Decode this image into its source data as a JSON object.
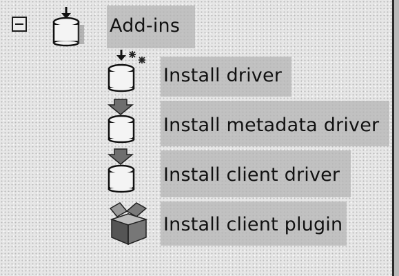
{
  "tree": {
    "root": {
      "label": "Add-ins",
      "expanded": true,
      "icon": "database-install-icon"
    },
    "children": [
      {
        "label": "Install driver",
        "icon": "database-install-sparkle-icon"
      },
      {
        "label": "Install metadata driver",
        "icon": "database-arrow-icon"
      },
      {
        "label": "Install client driver",
        "icon": "database-arrow-icon"
      },
      {
        "label": "Install client plugin",
        "icon": "package-box-icon"
      }
    ]
  }
}
